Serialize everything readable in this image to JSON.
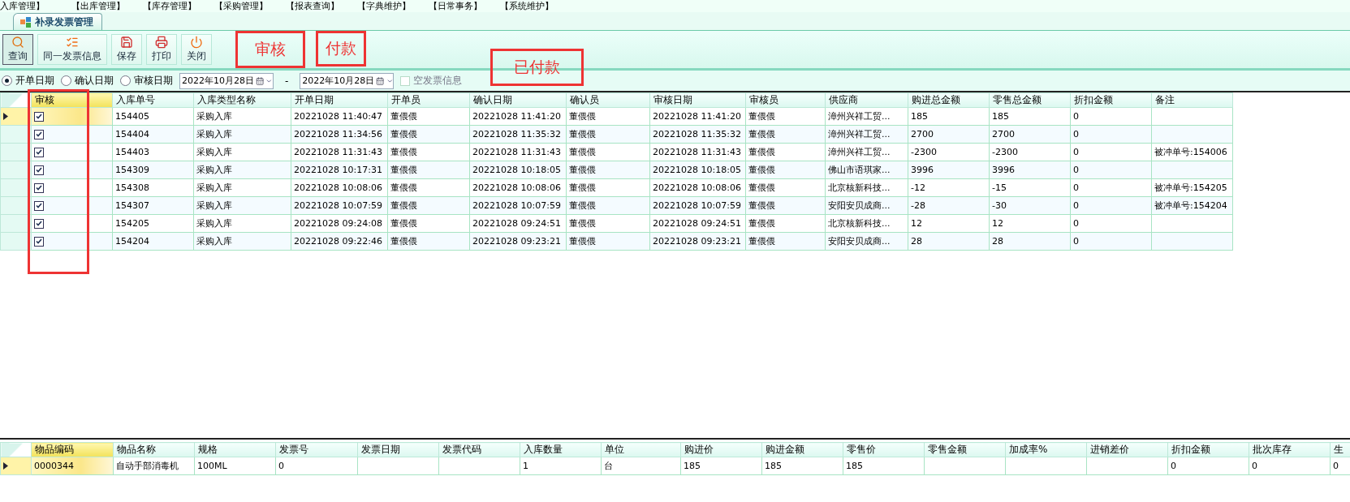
{
  "menu": [
    "入库管理】",
    "【出库管理】",
    "【库存管理】",
    "【采购管理】",
    "【报表查询】",
    "【字典维护】",
    "【日常事务】",
    "【系统维护】"
  ],
  "tab": {
    "title": "补录发票管理",
    "selected": true
  },
  "toolbar": [
    {
      "kind": "search",
      "label": "查询",
      "selected": true
    },
    {
      "kind": "list",
      "label": "同一发票信息",
      "selected": false
    },
    {
      "kind": "save",
      "label": "保存",
      "selected": false
    },
    {
      "kind": "print",
      "label": "打印",
      "selected": false
    },
    {
      "kind": "close",
      "label": "关闭",
      "selected": false
    }
  ],
  "filter": {
    "date_types": [
      {
        "label": "开单日期",
        "selected": true
      },
      {
        "label": "确认日期",
        "selected": false
      },
      {
        "label": "审核日期",
        "selected": false
      }
    ],
    "from": "2022年10月28日",
    "separator": "-",
    "to": "2022年10月28日",
    "empty_invoice": {
      "label": "空发票信息",
      "checked": false
    }
  },
  "main_table": {
    "columns": [
      "审核",
      "入库单号",
      "入库类型名称",
      "开单日期",
      "开单员",
      "确认日期",
      "确认员",
      "审核日期",
      "审核员",
      "供应商",
      "购进总金额",
      "零售总金额",
      "折扣金额",
      "备注"
    ],
    "rows": [
      {
        "selected": true,
        "checked": true,
        "cells": [
          "",
          "154405",
          "采购入库",
          "20221028 11:40:47",
          "董偎偎",
          "20221028 11:41:20",
          "董偎偎",
          "20221028 11:41:20",
          "董偎偎",
          "漳州兴祥工贸...",
          "185",
          "185",
          "0",
          ""
        ]
      },
      {
        "selected": false,
        "checked": true,
        "cells": [
          "",
          "154404",
          "采购入库",
          "20221028 11:34:56",
          "董偎偎",
          "20221028 11:35:32",
          "董偎偎",
          "20221028 11:35:32",
          "董偎偎",
          "漳州兴祥工贸...",
          "2700",
          "2700",
          "0",
          ""
        ]
      },
      {
        "selected": false,
        "checked": true,
        "cells": [
          "",
          "154403",
          "采购入库",
          "20221028 11:31:43",
          "董偎偎",
          "20221028 11:31:43",
          "董偎偎",
          "20221028 11:31:43",
          "董偎偎",
          "漳州兴祥工贸...",
          "-2300",
          "-2300",
          "0",
          "被冲单号:154006"
        ]
      },
      {
        "selected": false,
        "checked": true,
        "cells": [
          "",
          "154309",
          "采购入库",
          "20221028 10:17:31",
          "董偎偎",
          "20221028 10:18:05",
          "董偎偎",
          "20221028 10:18:05",
          "董偎偎",
          "佛山市语琪家...",
          "3996",
          "3996",
          "0",
          ""
        ]
      },
      {
        "selected": false,
        "checked": true,
        "cells": [
          "",
          "154308",
          "采购入库",
          "20221028 10:08:06",
          "董偎偎",
          "20221028 10:08:06",
          "董偎偎",
          "20221028 10:08:06",
          "董偎偎",
          "北京核新科技...",
          "-12",
          "-15",
          "0",
          "被冲单号:154205"
        ]
      },
      {
        "selected": false,
        "checked": true,
        "cells": [
          "",
          "154307",
          "采购入库",
          "20221028 10:07:59",
          "董偎偎",
          "20221028 10:07:59",
          "董偎偎",
          "20221028 10:07:59",
          "董偎偎",
          "安阳安贝成商...",
          "-28",
          "-30",
          "0",
          "被冲单号:154204"
        ]
      },
      {
        "selected": false,
        "checked": true,
        "cells": [
          "",
          "154205",
          "采购入库",
          "20221028 09:24:08",
          "董偎偎",
          "20221028 09:24:51",
          "董偎偎",
          "20221028 09:24:51",
          "董偎偎",
          "北京核新科技...",
          "12",
          "12",
          "0",
          ""
        ]
      },
      {
        "selected": false,
        "checked": true,
        "cells": [
          "",
          "154204",
          "采购入库",
          "20221028 09:22:46",
          "董偎偎",
          "20221028 09:23:21",
          "董偎偎",
          "20221028 09:23:21",
          "董偎偎",
          "安阳安贝成商...",
          "28",
          "28",
          "0",
          ""
        ]
      }
    ]
  },
  "detail_table": {
    "columns": [
      "物品编码",
      "物品名称",
      "规格",
      "发票号",
      "发票日期",
      "发票代码",
      "入库数量",
      "单位",
      "购进价",
      "购进金额",
      "零售价",
      "零售金额",
      "加成率%",
      "进销差价",
      "折扣金额",
      "批次库存",
      "生"
    ],
    "rows": [
      {
        "selected": true,
        "cells": [
          "0000344",
          "自动手部消毒机",
          "100ML",
          "0",
          "",
          "",
          "1",
          "台",
          "185",
          "185",
          "185",
          "",
          "",
          "",
          "0",
          "0",
          "0"
        ]
      }
    ]
  },
  "annotations": [
    {
      "kind": "label",
      "text": "审核"
    },
    {
      "kind": "label",
      "text": "付款"
    },
    {
      "kind": "label",
      "text": "已付款"
    },
    {
      "kind": "outline"
    }
  ]
}
